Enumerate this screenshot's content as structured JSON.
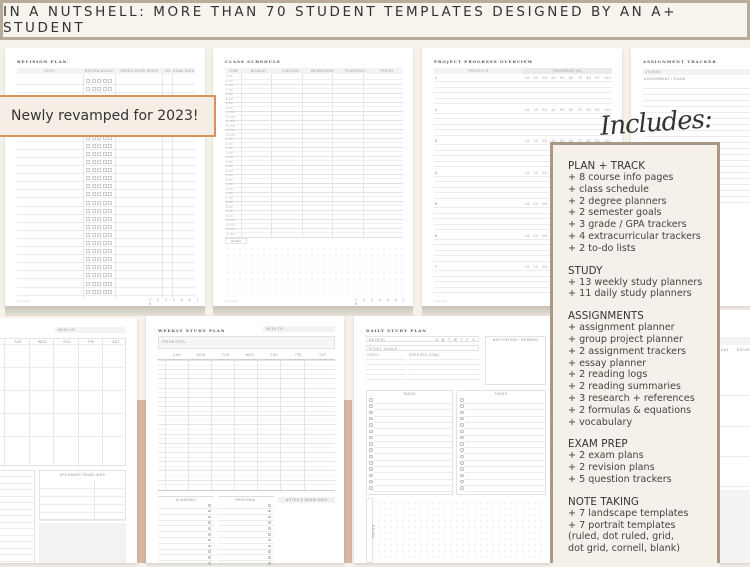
{
  "banner": {
    "text": "IN A NUTSHELL: MORE THAN 70 STUDENT TEMPLATES DESIGNED BY AN A+ STUDENT"
  },
  "badge": {
    "text": "Newly revamped for 2023!"
  },
  "includes": {
    "script_title": "Includes:",
    "sections": [
      {
        "heading": "PLAN + TRACK",
        "items": [
          "+ 8 course info pages",
          "+ class schedule",
          "+ 2 degree planners",
          "+ 2 semester goals",
          "+ 3 grade / GPA trackers",
          "+ 4 extracurricular trackers",
          "+ 2 to-do lists"
        ]
      },
      {
        "heading": "STUDY",
        "items": [
          "+ 13 weekly study planners",
          "+ 11 daily study planners"
        ]
      },
      {
        "heading": "ASSIGNMENTS",
        "items": [
          "+ assignment planner",
          "+ group project planner",
          "+ 2 assignment trackers",
          "+ essay planner",
          "+ 2 reading logs",
          "+ 2 reading summaries",
          "+ 3 research + references",
          "+ 2 formulas & equations",
          "+ vocabulary"
        ]
      },
      {
        "heading": "EXAM PREP",
        "items": [
          "+ 2 exam plans",
          "+ 2 revision plans",
          "+ 5 question trackers"
        ]
      },
      {
        "heading": "NOTE TAKING",
        "items": [
          "+ 7 landscape templates",
          "+ 7 portrait templates",
          "(ruled, dot ruled, grid,",
          " dot grid, cornell, blank)"
        ]
      }
    ]
  },
  "pages": {
    "revision": {
      "title": "REVISION PLAN",
      "cols": [
        "TOPIC",
        "REVIEW AGAIN",
        "NEEDS MORE WORK",
        "/10",
        "EXAM DATE"
      ],
      "page_numbers": "1 2 3 4 5 6 7 8"
    },
    "schedule": {
      "title": "CLASS SCHEDULE",
      "cols": [
        "TIME",
        "MONDAY",
        "TUESDAY",
        "WEDNESDAY",
        "THURSDAY",
        "FRIDAY"
      ],
      "times": [
        "6:00",
        "6:30",
        "7:00",
        "7:30",
        "8:00",
        "8:30",
        "9:00",
        "9:30",
        "10:00",
        "10:30",
        "11:00",
        "11:30",
        "12:00",
        "12:30",
        "1:00",
        "1:30",
        "2:00",
        "2:30",
        "3:00",
        "3:30",
        "4:00",
        "4:30",
        "5:00",
        "5:30",
        "6:00",
        "6:30",
        "7:00",
        "7:30",
        "8:00",
        "8:30",
        "9:00",
        "9:30",
        "10:00",
        "10:30",
        "11:00",
        "11:30"
      ],
      "notes_label": "NOTES",
      "page_numbers": "1 2 3 4 5 6 7 8"
    },
    "project": {
      "title": "PROJECT PROGRESS OVERVIEW",
      "col_projects": "PROJECTS",
      "col_progress": "PROGRESS (%)",
      "progress_ticks": [
        "10",
        "20",
        "30",
        "40",
        "50",
        "60",
        "70",
        "80",
        "90",
        "100"
      ],
      "rows": [
        "1",
        "2",
        "3",
        "4",
        "5",
        "6",
        "7"
      ]
    },
    "assignment": {
      "title": "ASSIGNMENT TRACKER",
      "course_label": "COURSE",
      "assignment_label": "ASSIGNMENT / EXAM"
    },
    "weekly_left": {
      "week_of": "WEEK OF:",
      "days": [
        "TUE",
        "WED",
        "THU",
        "FRI",
        "SAT"
      ],
      "deadlines_label": "UPCOMING DEADLINES"
    },
    "weekly": {
      "title": "WEEKLY STUDY PLAN",
      "week_of": "WEEK OF:",
      "priorities": "PRIORITIES:",
      "days": [
        "SUN",
        "MON",
        "TUE",
        "WED",
        "THU",
        "FRI",
        "SAT"
      ],
      "academic": "ACADEMIC",
      "personal": "PERSONAL",
      "notes": "NOTES & DEADLINES"
    },
    "daily": {
      "title": "DAILY STUDY PLAN",
      "dates": "DATE(S)",
      "weekdays": "S M T W T F S",
      "study_goals": "STUDY GOALS",
      "topic": "TOPIC",
      "specific_goal": "SPECIFIC GOAL",
      "motivation": "MOTIVATION / REWARD",
      "tasks": "TASKS",
      "notes": "NOTES"
    },
    "right_partial": {
      "days": [
        "DAY",
        "SATUR"
      ]
    }
  }
}
